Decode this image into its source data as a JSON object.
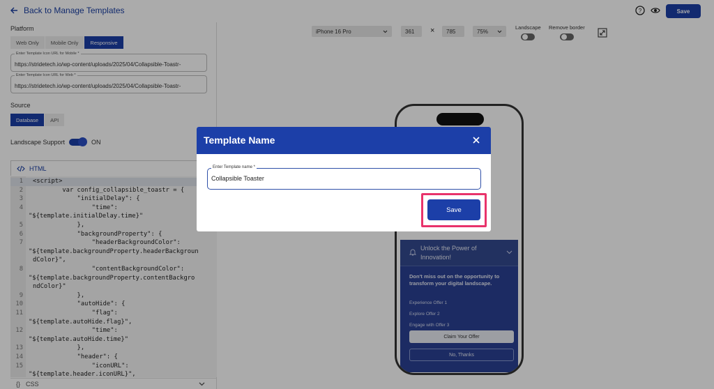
{
  "header": {
    "back_label": "Back to Manage Templates",
    "save_label": "Save"
  },
  "left": {
    "platform_label": "Platform",
    "platform_options": [
      "Web Only",
      "Mobile Only",
      "Responsive"
    ],
    "mobile_url_label": "Enter Template Icon URL for Mobile *",
    "mobile_url_value": "https://stridetech.io/wp-content/uploads/2025/04/Collapsible-Toastr-",
    "web_url_label": "Enter Template Icon URL for Web *",
    "web_url_value": "https://stridetech.io/wp-content/uploads/2025/04/Collapsible-Toastr-",
    "source_label": "Source",
    "source_options": [
      "Database",
      "API"
    ],
    "landscape_label": "Landscape Support",
    "landscape_state": "ON",
    "html_tab": "HTML",
    "css_tab": "CSS",
    "code_lines": [
      {
        "n": "1",
        "t": "<script>"
      },
      {
        "n": "2",
        "t": "        var config_collapsible_toastr = {"
      },
      {
        "n": "3",
        "t": "            \"initialDelay\": {"
      },
      {
        "n": "4",
        "t": "                \"time\":"
      },
      {
        "n": "",
        "t": "\"${template.initialDelay.time}\""
      },
      {
        "n": "5",
        "t": "            },"
      },
      {
        "n": "6",
        "t": "            \"backgroundProperty\": {"
      },
      {
        "n": "7",
        "t": "                \"headerBackgroundColor\":"
      },
      {
        "n": "",
        "t": "\"${template.backgroundProperty.headerBackgroun"
      },
      {
        "n": "",
        "t": "dColor}\","
      },
      {
        "n": "8",
        "t": "                \"contentBackgroundColor\":"
      },
      {
        "n": "",
        "t": "\"${template.backgroundProperty.contentBackgro"
      },
      {
        "n": "",
        "t": "ndColor}\""
      },
      {
        "n": "9",
        "t": "            },"
      },
      {
        "n": "10",
        "t": "            \"autoHide\": {"
      },
      {
        "n": "11",
        "t": "                \"flag\":"
      },
      {
        "n": "",
        "t": "\"${template.autoHide.flag}\","
      },
      {
        "n": "12",
        "t": "                \"time\":"
      },
      {
        "n": "",
        "t": "\"${template.autoHide.time}\""
      },
      {
        "n": "13",
        "t": "            },"
      },
      {
        "n": "14",
        "t": "            \"header\": {"
      },
      {
        "n": "15",
        "t": "                \"iconURL\":"
      },
      {
        "n": "",
        "t": "\"${template.header.iconURL}\","
      }
    ]
  },
  "preview": {
    "device": "iPhone 16 Pro",
    "width": "361",
    "times": "×",
    "height": "785",
    "zoom": "75%",
    "landscape_label": "Landscape",
    "remove_border_label": "Remove border"
  },
  "toast": {
    "title": "Unlock the Power of Innovation!",
    "subtitle": "Don't miss out on the opportunity to transform your digital landscape.",
    "offers": [
      "Experience Offer 1",
      "Explore Offer 2",
      "Engage with Offer 3"
    ],
    "claim": "Claim Your Offer",
    "dismiss": "No, Thanks"
  },
  "modal": {
    "title": "Template Name",
    "field_label": "Enter Template name *",
    "field_value": "Collapsible Toaster",
    "save": "Save"
  },
  "colors": {
    "primary": "#1c3fa8",
    "highlight": "#e8336b",
    "toast_bg": "#2a4194"
  }
}
